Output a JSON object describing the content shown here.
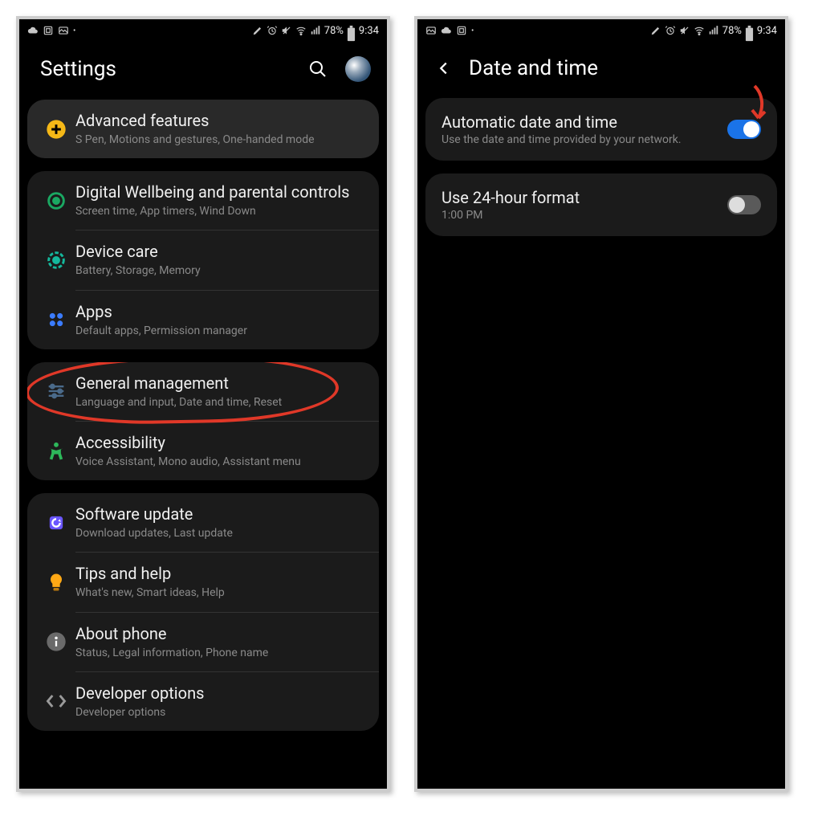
{
  "status": {
    "battery": "78%",
    "time": "9:34"
  },
  "left": {
    "title": "Settings",
    "groups": [
      {
        "items": [
          {
            "title": "Advanced features",
            "sub": "S Pen, Motions and gestures, One-handed mode",
            "icon": "advanced",
            "highlight": true
          }
        ]
      },
      {
        "items": [
          {
            "title": "Digital Wellbeing and parental controls",
            "sub": "Screen time, App timers, Wind Down",
            "icon": "wellbeing"
          },
          {
            "title": "Device care",
            "sub": "Battery, Storage, Memory",
            "icon": "devicecare"
          },
          {
            "title": "Apps",
            "sub": "Default apps, Permission manager",
            "icon": "apps"
          }
        ]
      },
      {
        "items": [
          {
            "title": "General management",
            "sub": "Language and input, Date and time, Reset",
            "icon": "general",
            "circled": true
          },
          {
            "title": "Accessibility",
            "sub": "Voice Assistant, Mono audio, Assistant menu",
            "icon": "accessibility"
          }
        ]
      },
      {
        "items": [
          {
            "title": "Software update",
            "sub": "Download updates, Last update",
            "icon": "update"
          },
          {
            "title": "Tips and help",
            "sub": "What's new, Smart ideas, Help",
            "icon": "tips"
          },
          {
            "title": "About phone",
            "sub": "Status, Legal information, Phone name",
            "icon": "about"
          },
          {
            "title": "Developer options",
            "sub": "Developer options",
            "icon": "dev"
          }
        ]
      }
    ]
  },
  "right": {
    "title": "Date and time",
    "items": [
      {
        "title": "Automatic date and time",
        "sub": "Use the date and time provided by your network.",
        "toggle": "on",
        "arrow": true
      },
      {
        "title": "Use 24-hour format",
        "sub": "1:00 PM",
        "toggle": "off"
      }
    ]
  }
}
